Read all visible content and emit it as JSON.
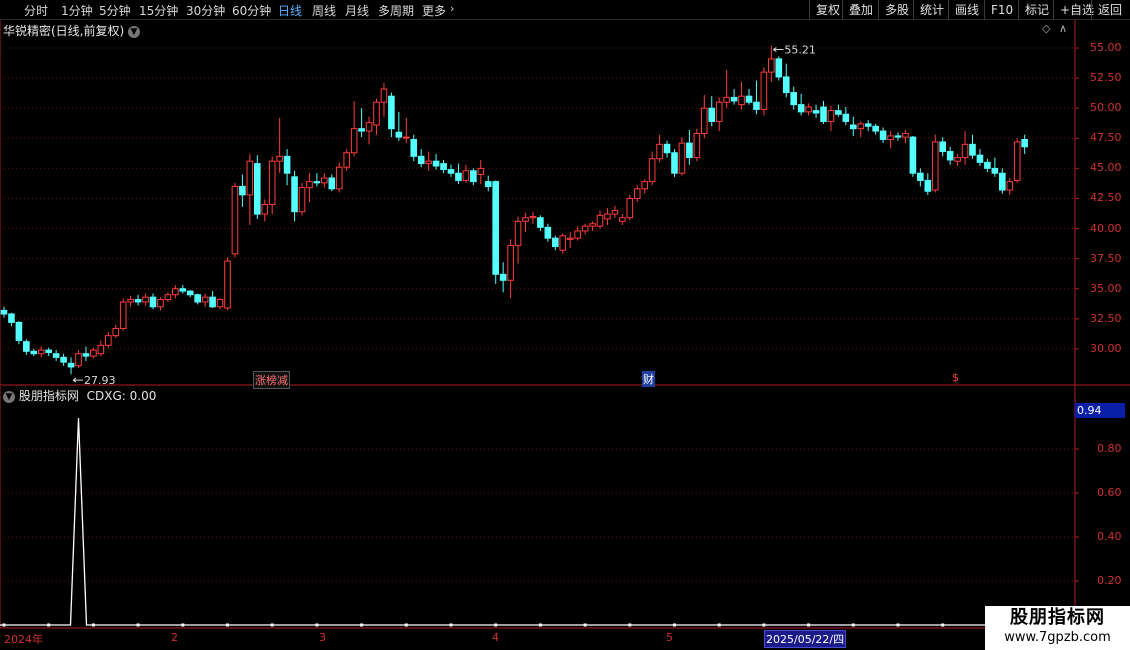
{
  "toolbar": {
    "periods": [
      "分时",
      "1分钟",
      "5分钟",
      "15分钟",
      "30分钟",
      "60分钟",
      "日线",
      "周线",
      "月线",
      "多周期",
      "更多"
    ],
    "active_period": "日线",
    "right_buttons": [
      "复权",
      "叠加",
      "多股",
      "统计",
      "画线",
      "F10",
      "标记",
      "+自选",
      "返回"
    ]
  },
  "main_panel": {
    "title": "华锐精密(日线,前复权)",
    "y_ticks": [
      "55.00",
      "52.50",
      "50.00",
      "47.50",
      "45.00",
      "42.50",
      "40.00",
      "37.50",
      "35.00",
      "32.50",
      "30.00"
    ],
    "high_label": "55.21",
    "low_label": "27.93",
    "event_badges": {
      "zhangbang": "涨榜减",
      "cai": "财",
      "dollar": "$"
    }
  },
  "indicator_panel": {
    "title": "股朋指标网",
    "value_label": "CDXG: 0.00",
    "y_ticks": [
      "0.80",
      "0.60",
      "0.40",
      "0.20"
    ],
    "current_value": "0.94"
  },
  "x_axis": {
    "labels": [
      "2024年",
      "2",
      "3",
      "4",
      "5"
    ],
    "cursor_date": "2025/05/22/四"
  },
  "watermark": {
    "line1": "股朋指标网",
    "line2": "www.7gpzb.com"
  },
  "colors": {
    "up": "#ff3c3c",
    "down": "#54ffff",
    "axis": "#b01e1e",
    "blue_accent": "#5ab0ff"
  },
  "chart_data": {
    "type": "candlestick",
    "price_range": [
      27.0,
      56.5
    ],
    "ohlc": [
      [
        33.2,
        33.5,
        32.6,
        32.9
      ],
      [
        32.9,
        33.0,
        31.9,
        32.2
      ],
      [
        32.2,
        32.3,
        30.4,
        30.7
      ],
      [
        30.6,
        30.8,
        29.5,
        29.8
      ],
      [
        29.8,
        30.0,
        29.4,
        29.6
      ],
      [
        29.6,
        30.2,
        29.3,
        29.9
      ],
      [
        29.9,
        30.1,
        29.4,
        29.7
      ],
      [
        29.6,
        29.9,
        29.0,
        29.3
      ],
      [
        29.3,
        29.6,
        28.6,
        28.9
      ],
      [
        28.8,
        29.3,
        27.9,
        28.5
      ],
      [
        28.6,
        29.9,
        28.4,
        29.6
      ],
      [
        29.6,
        30.2,
        29.0,
        29.4
      ],
      [
        29.4,
        30.1,
        29.2,
        29.9
      ],
      [
        29.6,
        30.7,
        29.4,
        30.3
      ],
      [
        30.3,
        31.4,
        30.1,
        31.1
      ],
      [
        31.1,
        32.0,
        30.9,
        31.7
      ],
      [
        31.7,
        34.2,
        31.5,
        33.9
      ],
      [
        33.9,
        34.4,
        33.5,
        34.1
      ],
      [
        34.1,
        34.5,
        33.6,
        33.9
      ],
      [
        33.9,
        34.6,
        33.6,
        34.3
      ],
      [
        34.3,
        34.6,
        33.3,
        33.5
      ],
      [
        33.5,
        34.3,
        33.2,
        34.1
      ],
      [
        34.1,
        34.7,
        33.9,
        34.5
      ],
      [
        34.5,
        35.3,
        34.2,
        35.0
      ],
      [
        35.0,
        35.3,
        34.6,
        34.8
      ],
      [
        34.8,
        34.9,
        34.3,
        34.5
      ],
      [
        34.5,
        34.6,
        33.7,
        33.9
      ],
      [
        33.9,
        34.6,
        33.5,
        34.3
      ],
      [
        34.3,
        34.8,
        33.4,
        33.5
      ],
      [
        33.5,
        34.2,
        33.3,
        34.1
      ],
      [
        33.4,
        37.6,
        33.2,
        37.3
      ],
      [
        37.9,
        43.8,
        37.6,
        43.5
      ],
      [
        43.5,
        44.5,
        41.8,
        42.8
      ],
      [
        42.8,
        46.2,
        40.3,
        45.6
      ],
      [
        45.4,
        46.1,
        40.8,
        41.2
      ],
      [
        41.2,
        42.4,
        40.6,
        42.0
      ],
      [
        42.0,
        46.0,
        41.2,
        45.6
      ],
      [
        45.6,
        49.2,
        44.6,
        46.0
      ],
      [
        46.0,
        46.6,
        43.6,
        44.6
      ],
      [
        44.3,
        44.8,
        40.6,
        41.4
      ],
      [
        41.4,
        43.8,
        41.1,
        43.4
      ],
      [
        43.4,
        44.6,
        42.2,
        43.9
      ],
      [
        43.9,
        44.6,
        43.5,
        43.8
      ],
      [
        43.8,
        44.6,
        43.4,
        44.2
      ],
      [
        44.2,
        44.5,
        43.1,
        43.3
      ],
      [
        43.3,
        45.5,
        43.0,
        45.1
      ],
      [
        45.1,
        46.6,
        44.8,
        46.3
      ],
      [
        46.3,
        50.6,
        46.0,
        48.3
      ],
      [
        48.3,
        50.0,
        47.6,
        48.1
      ],
      [
        48.1,
        49.3,
        47.0,
        48.8
      ],
      [
        48.6,
        50.8,
        47.8,
        50.5
      ],
      [
        50.5,
        52.1,
        49.3,
        51.6
      ],
      [
        51.0,
        51.3,
        47.6,
        48.3
      ],
      [
        48.0,
        49.7,
        47.3,
        47.6
      ],
      [
        47.6,
        49.2,
        47.1,
        47.6
      ],
      [
        47.4,
        47.8,
        45.6,
        46.0
      ],
      [
        46.0,
        46.6,
        45.1,
        45.4
      ],
      [
        45.4,
        46.4,
        44.8,
        45.6
      ],
      [
        45.6,
        46.2,
        44.9,
        45.2
      ],
      [
        45.4,
        45.7,
        44.6,
        44.9
      ],
      [
        44.9,
        45.3,
        44.3,
        44.6
      ],
      [
        44.6,
        45.4,
        43.7,
        44.0
      ],
      [
        44.0,
        45.3,
        43.8,
        44.8
      ],
      [
        44.8,
        45.0,
        43.6,
        43.9
      ],
      [
        44.5,
        45.7,
        43.7,
        45.0
      ],
      [
        43.9,
        44.4,
        43.1,
        43.5
      ],
      [
        43.9,
        44.0,
        35.4,
        36.2
      ],
      [
        36.2,
        37.2,
        34.7,
        35.7
      ],
      [
        35.7,
        39.1,
        34.2,
        38.6
      ],
      [
        38.6,
        41.0,
        37.1,
        40.6
      ],
      [
        40.6,
        41.3,
        39.7,
        40.9
      ],
      [
        40.9,
        41.4,
        40.4,
        41.0
      ],
      [
        40.9,
        41.1,
        39.8,
        40.1
      ],
      [
        40.1,
        40.4,
        38.9,
        39.2
      ],
      [
        39.2,
        39.4,
        38.2,
        38.5
      ],
      [
        38.2,
        39.6,
        37.9,
        39.4
      ],
      [
        39.1,
        39.7,
        38.4,
        39.2
      ],
      [
        39.2,
        40.2,
        39.0,
        39.8
      ],
      [
        39.8,
        40.4,
        39.5,
        40.2
      ],
      [
        40.2,
        40.6,
        39.8,
        40.4
      ],
      [
        40.2,
        41.5,
        40.0,
        41.1
      ],
      [
        40.8,
        41.7,
        40.3,
        41.2
      ],
      [
        41.2,
        41.9,
        40.9,
        41.5
      ],
      [
        40.6,
        41.2,
        40.3,
        40.9
      ],
      [
        40.9,
        42.8,
        40.7,
        42.5
      ],
      [
        42.5,
        43.6,
        42.2,
        43.3
      ],
      [
        43.3,
        44.1,
        42.9,
        43.9
      ],
      [
        43.9,
        46.4,
        43.6,
        45.8
      ],
      [
        45.8,
        47.8,
        45.5,
        47.0
      ],
      [
        47.0,
        47.3,
        45.9,
        46.3
      ],
      [
        46.3,
        46.6,
        44.3,
        44.6
      ],
      [
        44.6,
        47.6,
        44.4,
        47.1
      ],
      [
        47.1,
        48.2,
        45.3,
        45.9
      ],
      [
        45.9,
        48.3,
        45.6,
        47.9
      ],
      [
        47.9,
        51.1,
        47.5,
        50.0
      ],
      [
        50.0,
        51.0,
        48.5,
        48.9
      ],
      [
        48.9,
        50.9,
        48.1,
        50.5
      ],
      [
        50.5,
        53.2,
        50.0,
        50.9
      ],
      [
        50.9,
        51.6,
        50.3,
        50.6
      ],
      [
        50.3,
        52.2,
        49.9,
        51.0
      ],
      [
        51.0,
        51.6,
        50.3,
        50.5
      ],
      [
        50.5,
        52.3,
        49.5,
        49.9
      ],
      [
        49.9,
        53.4,
        49.4,
        53.0
      ],
      [
        53.0,
        55.21,
        52.2,
        54.1
      ],
      [
        54.1,
        54.3,
        52.3,
        52.6
      ],
      [
        52.6,
        53.7,
        50.9,
        51.3
      ],
      [
        51.3,
        51.8,
        49.9,
        50.3
      ],
      [
        50.3,
        51.2,
        49.4,
        49.7
      ],
      [
        49.7,
        50.4,
        49.4,
        50.1
      ],
      [
        49.8,
        50.3,
        49.2,
        49.6
      ],
      [
        50.1,
        50.6,
        48.7,
        48.9
      ],
      [
        48.9,
        50.2,
        48.1,
        49.8
      ],
      [
        49.8,
        50.3,
        49.3,
        49.5
      ],
      [
        49.5,
        50.1,
        48.6,
        48.9
      ],
      [
        48.6,
        49.3,
        47.7,
        48.3
      ],
      [
        48.3,
        48.9,
        47.6,
        48.7
      ],
      [
        48.7,
        49.0,
        48.1,
        48.5
      ],
      [
        48.5,
        48.7,
        47.8,
        48.1
      ],
      [
        48.1,
        48.4,
        47.1,
        47.4
      ],
      [
        47.4,
        48.1,
        46.7,
        47.7
      ],
      [
        47.7,
        48.0,
        47.3,
        47.6
      ],
      [
        47.6,
        48.2,
        47.1,
        47.9
      ],
      [
        47.6,
        47.7,
        44.3,
        44.6
      ],
      [
        44.6,
        45.0,
        43.5,
        44.0
      ],
      [
        44.0,
        44.6,
        42.8,
        43.1
      ],
      [
        43.2,
        47.8,
        43.0,
        47.2
      ],
      [
        47.2,
        47.6,
        46.0,
        46.4
      ],
      [
        46.4,
        46.8,
        45.3,
        45.7
      ],
      [
        45.6,
        46.2,
        45.2,
        45.9
      ],
      [
        45.9,
        48.1,
        45.3,
        47.0
      ],
      [
        47.0,
        47.8,
        45.8,
        46.1
      ],
      [
        46.1,
        46.6,
        45.2,
        45.5
      ],
      [
        45.5,
        45.8,
        44.7,
        45.0
      ],
      [
        45.0,
        45.9,
        44.3,
        44.6
      ],
      [
        44.6,
        45.0,
        42.9,
        43.2
      ],
      [
        43.2,
        44.2,
        42.8,
        43.9
      ],
      [
        44.0,
        47.5,
        43.8,
        47.2
      ],
      [
        47.4,
        47.8,
        46.2,
        46.8
      ]
    ],
    "indicator": {
      "name": "CDXG",
      "peak_index": 10,
      "peak_value": 0.94,
      "baseline": 0.0
    }
  }
}
